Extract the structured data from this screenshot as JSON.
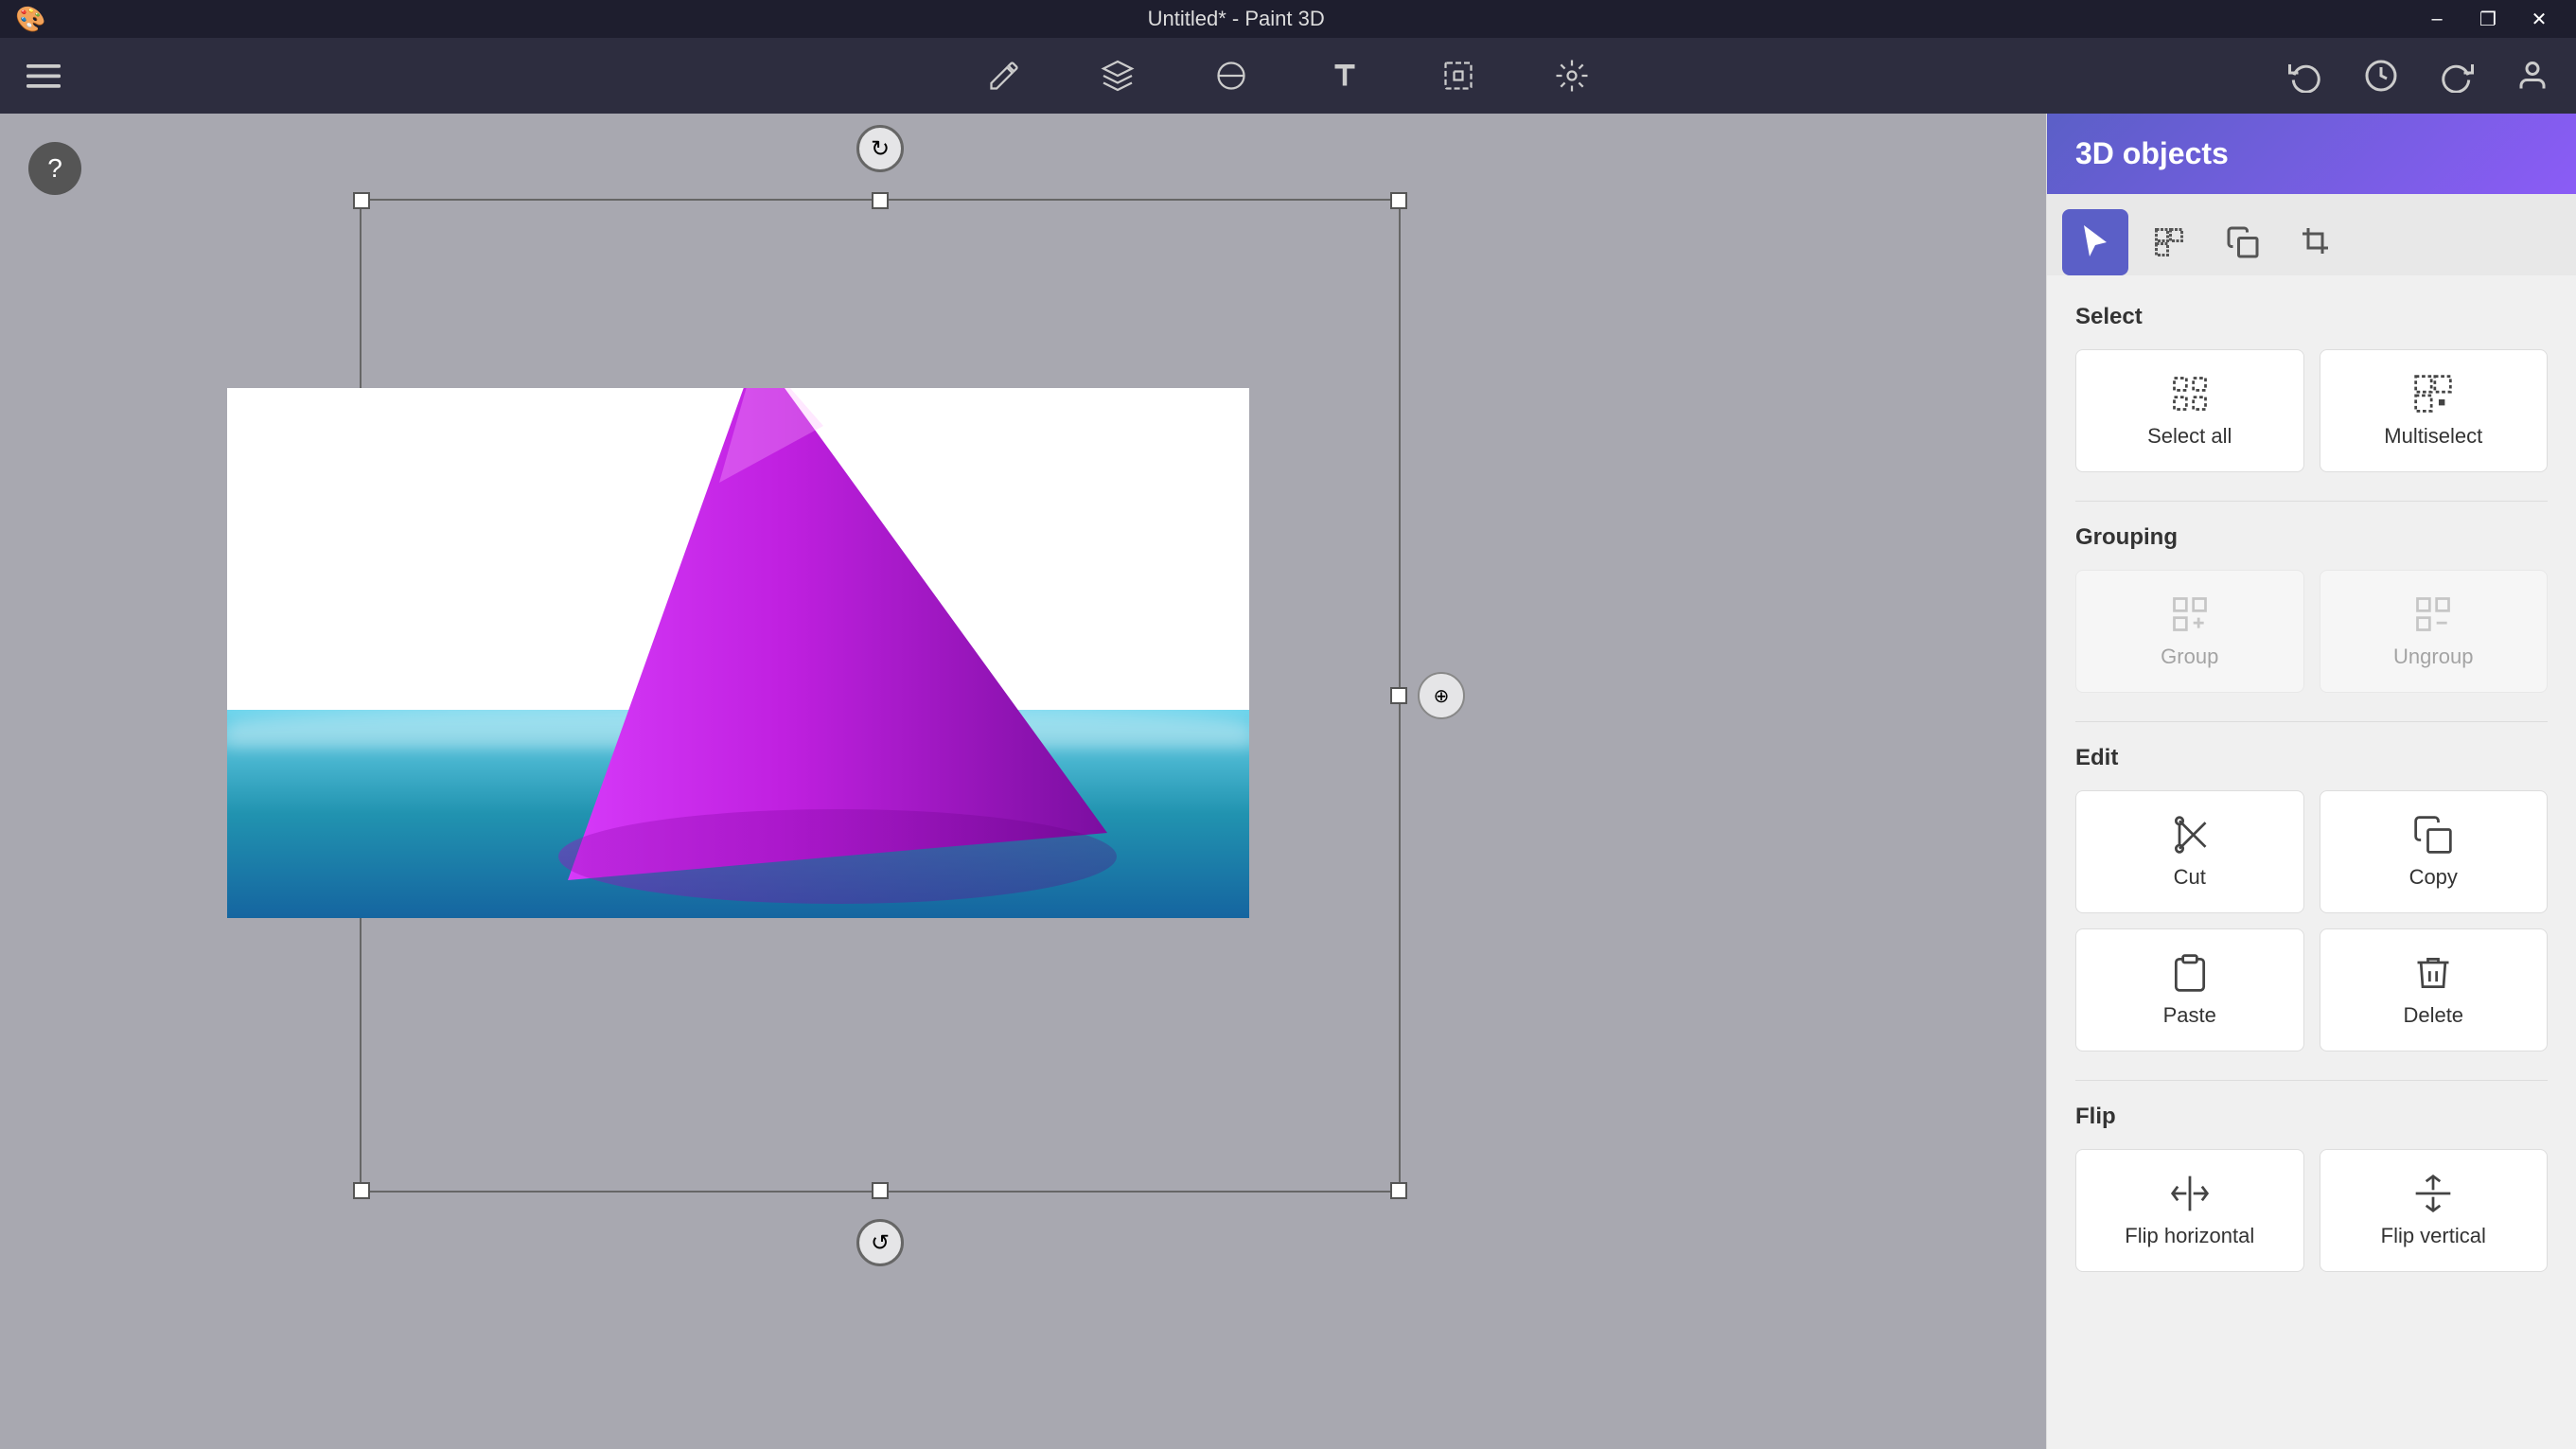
{
  "titlebar": {
    "title": "Untitled* - Paint 3D",
    "minimize": "–",
    "maximize": "❐",
    "close": "✕"
  },
  "toolbar": {
    "menu_icon": "☰",
    "tools": [
      {
        "name": "brush-tool",
        "label": "Brushes"
      },
      {
        "name": "3d-tool",
        "label": "3D shapes"
      },
      {
        "name": "2d-tool",
        "label": "2D shapes"
      },
      {
        "name": "text-tool",
        "label": "Text"
      },
      {
        "name": "select-tool",
        "label": "Select"
      },
      {
        "name": "effects-tool",
        "label": "Effects"
      }
    ],
    "undo": "↩",
    "history": "🕐",
    "redo": "↪",
    "profile": "👤"
  },
  "panel": {
    "title": "3D objects",
    "tabs": [
      {
        "name": "select-tab",
        "icon": "cursor",
        "active": true
      },
      {
        "name": "multiselect-tab",
        "icon": "multiselect",
        "active": false
      },
      {
        "name": "copy-tab",
        "icon": "copy-obj",
        "active": false
      },
      {
        "name": "crop-tab",
        "icon": "crop-obj",
        "active": false
      }
    ],
    "select_section": "Select",
    "select_all_label": "Select all",
    "multiselect_label": "Multiselect",
    "grouping_section": "Grouping",
    "group_label": "Group",
    "ungroup_label": "Ungroup",
    "edit_section": "Edit",
    "cut_label": "Cut",
    "copy_label": "Copy",
    "paste_label": "Paste",
    "delete_label": "Delete",
    "flip_section": "Flip",
    "flip_horizontal_label": "Flip horizontal",
    "flip_vertical_label": "Flip vertical"
  },
  "help": "?"
}
